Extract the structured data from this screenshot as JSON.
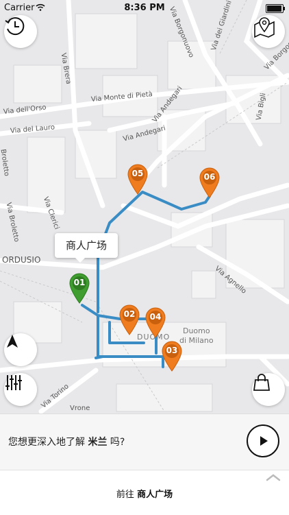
{
  "status_bar": {
    "carrier": "Carrier",
    "time": "8:36 PM",
    "battery_percent": 95
  },
  "map": {
    "streets": [
      "Via Brera",
      "Via Borgonuovo",
      "Via dei Giardini",
      "Via Borgospesso",
      "Via Monte di Pietà",
      "Via dell'Orso",
      "Via del Lauro",
      "Via Andegari",
      "Via Andegari",
      "Via Bigli",
      "Via Broletto",
      "Via Clerici",
      "Via Agnello",
      "Via Torino",
      "Vrone",
      "Broletto"
    ],
    "places": {
      "area_label": "ORDUSIO",
      "duomo_square": "DUOMO",
      "duomo_name": "Duomo\ndi Milano"
    },
    "callout": "商人广场",
    "pins": [
      {
        "number": "01",
        "color": "#3f9e2f"
      },
      {
        "number": "02",
        "color": "#ef7c1e"
      },
      {
        "number": "03",
        "color": "#ef7c1e"
      },
      {
        "number": "04",
        "color": "#ef7c1e"
      },
      {
        "number": "05",
        "color": "#ef7c1e"
      },
      {
        "number": "06",
        "color": "#ef7c1e"
      }
    ],
    "route_color": "#3a8cc4"
  },
  "icons": {
    "history": "clock-history-icon",
    "tour_map": "map-pin-icon",
    "locate": "location-arrow-icon",
    "filters": "sliders-icon",
    "shop": "shopping-bag-icon",
    "play": "play-icon",
    "chevron": "chevron-up-icon"
  },
  "bottom": {
    "prompt_before": "您想更深入地了解 ",
    "prompt_city": "米兰",
    "prompt_after": " 吗?",
    "go_prefix": "前往 ",
    "go_destination": "商人广场"
  }
}
